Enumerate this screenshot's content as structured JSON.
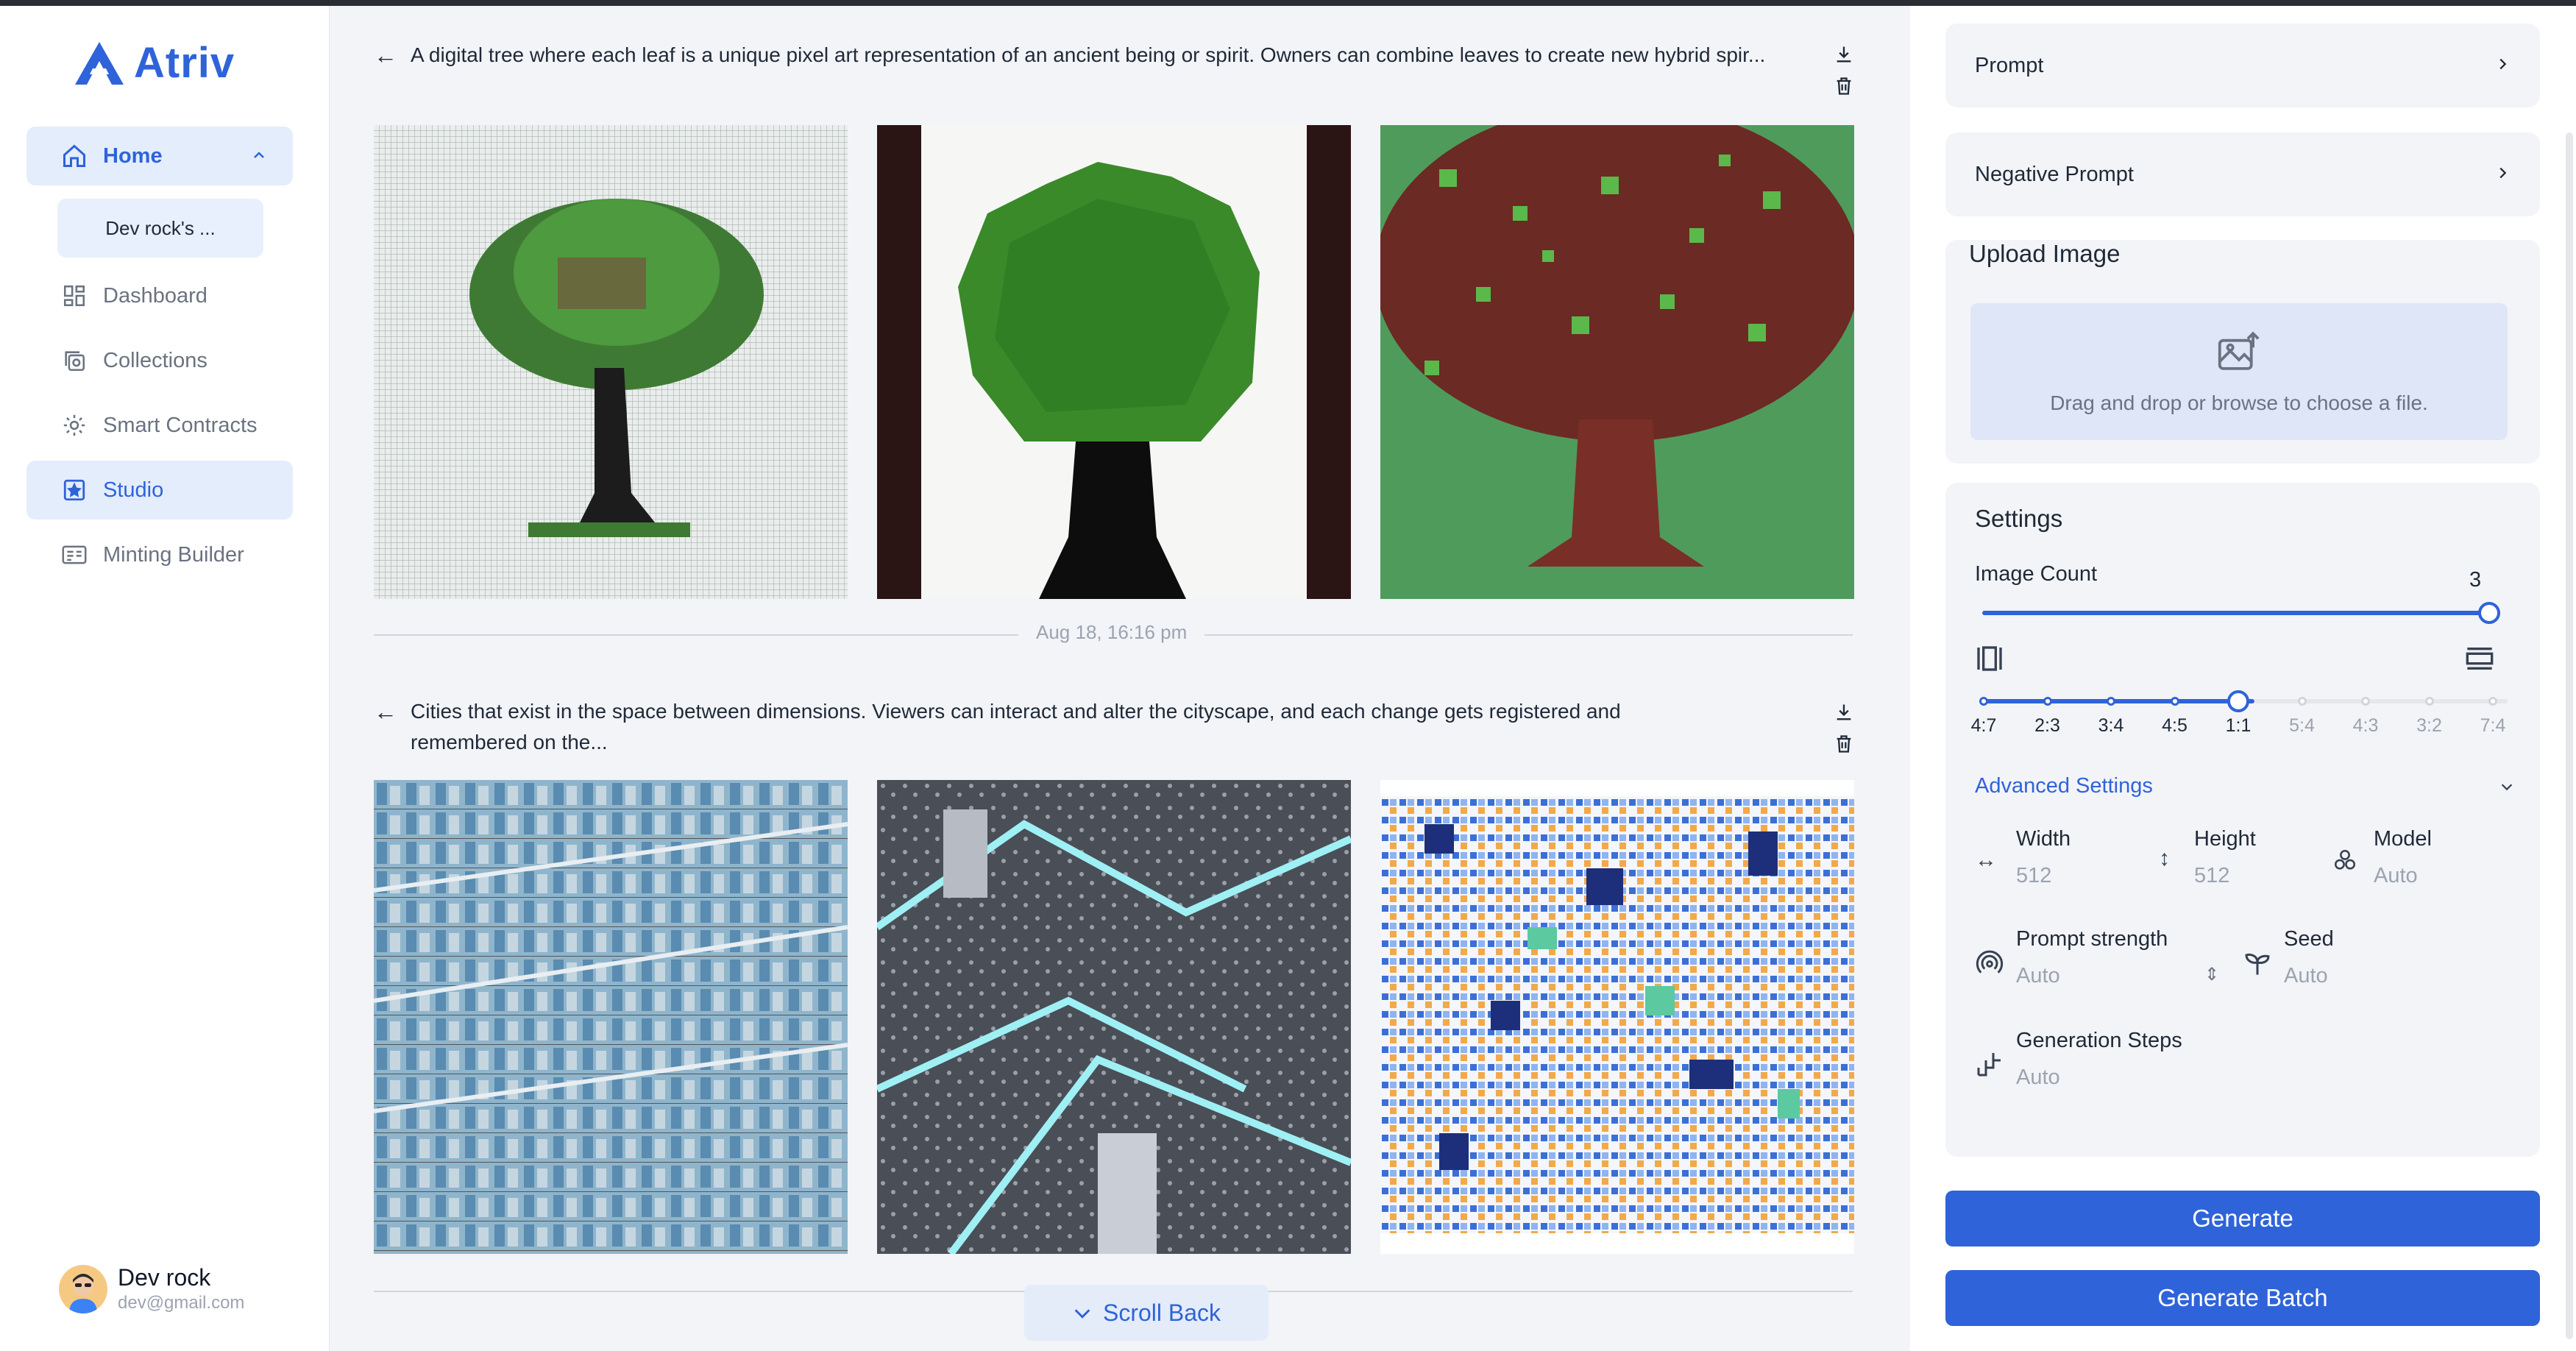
{
  "app": {
    "name": "Atriv"
  },
  "sidebar": {
    "home_label": "Home",
    "sub_item": "Dev rock's ...",
    "items": [
      {
        "label": "Dashboard",
        "icon": "dashboard-icon"
      },
      {
        "label": "Collections",
        "icon": "collections-icon"
      },
      {
        "label": "Smart Contracts",
        "icon": "gear-icon"
      },
      {
        "label": "Studio",
        "icon": "studio-icon"
      },
      {
        "label": "Minting Builder",
        "icon": "minting-icon"
      }
    ],
    "user": {
      "name": "Dev rock",
      "email": "dev@gmail.com"
    }
  },
  "feed": {
    "generations": [
      {
        "prompt": "A digital tree where each leaf is a unique pixel art representation of an ancient being or spirit. Owners can combine leaves to create new hybrid spir...",
        "images": [
          "pixel-tree-grid",
          "pixel-tree-green",
          "pixel-tree-red"
        ]
      },
      {
        "prompt": "Cities that exist in the space between dimensions. Viewers can interact and alter the cityscape, and each change gets registered and remembered on the...",
        "images": [
          "isometric-city-blue",
          "isometric-city-grid",
          "mosaic-city"
        ]
      }
    ],
    "timestamp": "Aug 18, 16:16 pm",
    "scroll_back": "Scroll Back"
  },
  "panel": {
    "prompt_label": "Prompt",
    "negative_prompt_label": "Negative Prompt",
    "upload_title": "Upload Image",
    "upload_hint": "Drag and drop or browse to choose a file.",
    "settings_title": "Settings",
    "image_count_label": "Image Count",
    "image_count_value": "3",
    "aspect_ratios": [
      "4:7",
      "2:3",
      "3:4",
      "4:5",
      "1:1",
      "5:4",
      "4:3",
      "3:2",
      "7:4"
    ],
    "selected_ratio": "1:1",
    "advanced_label": "Advanced Settings",
    "width_label": "Width",
    "width_value": "512",
    "height_label": "Height",
    "height_value": "512",
    "model_label": "Model",
    "model_value": "Auto",
    "prompt_strength_label": "Prompt strength",
    "prompt_strength_value": "Auto",
    "seed_label": "Seed",
    "seed_value": "Auto",
    "steps_label": "Generation Steps",
    "steps_value": "Auto",
    "generate_label": "Generate",
    "generate_batch_label": "Generate Batch"
  },
  "colors": {
    "accent": "#2f63d9",
    "accent_light": "#e4edfc"
  }
}
